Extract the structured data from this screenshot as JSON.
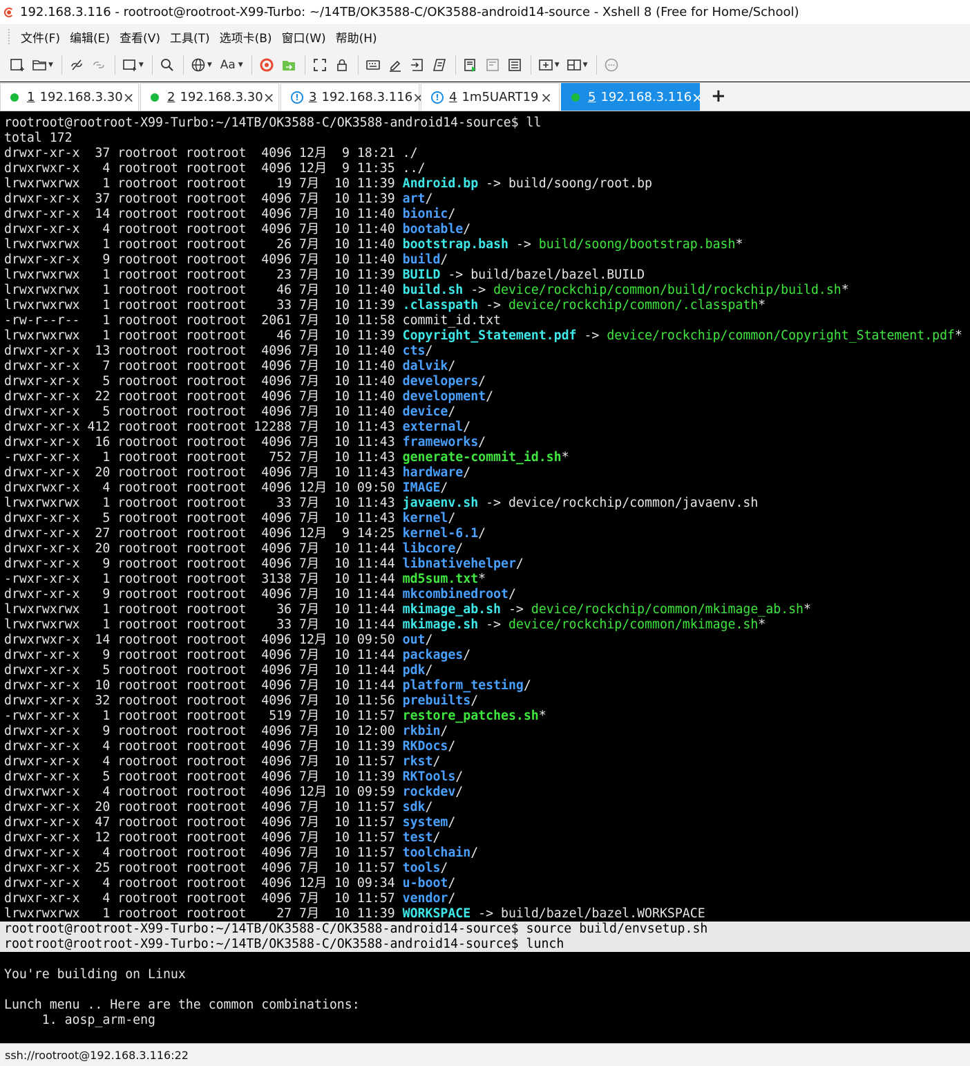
{
  "window": {
    "title": "192.168.3.116 - rootroot@rootroot-X99-Turbo: ~/14TB/OK3588-C/OK3588-android14-source - Xshell 8 (Free for Home/School)"
  },
  "menu": [
    "文件(F)",
    "编辑(E)",
    "查看(V)",
    "工具(T)",
    "选项卡(B)",
    "窗口(W)",
    "帮助(H)"
  ],
  "toolbar": {
    "font_label": "Aa",
    "icons": [
      "new-session-icon",
      "open-folder-icon",
      "disconnect-icon",
      "reconnect-icon",
      "new-window-icon",
      "find-icon",
      "globe-icon",
      "font-icon",
      "xshell-logo-icon",
      "xftp-icon",
      "fullscreen-icon",
      "lock-icon",
      "keyboard-icon",
      "highlight-icon",
      "transfer-icon",
      "script-icon",
      "compose-icon",
      "compose-bar-icon",
      "compose-pane-icon",
      "add-tab-icon",
      "layout-icon",
      "chat-icon"
    ]
  },
  "tabs": [
    {
      "num": "1",
      "host": "192.168.3.30",
      "status": "connected",
      "active": false
    },
    {
      "num": "2",
      "host": "192.168.3.30",
      "status": "connected",
      "active": false
    },
    {
      "num": "3",
      "host": "192.168.3.116",
      "status": "warning",
      "active": false
    },
    {
      "num": "4",
      "host": "1m5UART19",
      "status": "warning",
      "active": false
    },
    {
      "num": "5",
      "host": "192.168.3.116",
      "status": "connected",
      "active": true
    }
  ],
  "tab_close_glyph": "×",
  "tab_add_glyph": "+",
  "terminal": {
    "prompt": "rootroot@rootroot-X99-Turbo:~/14TB/OK3588-C/OK3588-android14-source$",
    "commands": {
      "ll": "ll",
      "source": "source build/envsetup.sh",
      "lunch": "lunch"
    },
    "total": "total 172",
    "listing": [
      {
        "meta": "drwxr-xr-x  37 rootroot rootroot  4096 12月  9 18:21",
        "name": "./",
        "kind": "plain"
      },
      {
        "meta": "drwxrwxr-x   4 rootroot rootroot  4096 12月  9 11:35",
        "name": "../",
        "kind": "plain"
      },
      {
        "meta": "lrwxrwxrwx   1 rootroot rootroot    19 7月  10 11:39",
        "name": "Android.bp",
        "kind": "lnk",
        "arrow": "->",
        "target": "build/soong/root.bp",
        "tkind": "plain",
        "star": ""
      },
      {
        "meta": "drwxr-xr-x  37 rootroot rootroot  4096 7月  10 11:39",
        "name": "art",
        "kind": "dir"
      },
      {
        "meta": "drwxr-xr-x  14 rootroot rootroot  4096 7月  10 11:40",
        "name": "bionic",
        "kind": "dir"
      },
      {
        "meta": "drwxr-xr-x   4 rootroot rootroot  4096 7月  10 11:40",
        "name": "bootable",
        "kind": "dir"
      },
      {
        "meta": "lrwxrwxrwx   1 rootroot rootroot    26 7月  10 11:40",
        "name": "bootstrap.bash",
        "kind": "lnk",
        "arrow": "->",
        "target": "build/soong/bootstrap.bash",
        "tkind": "exe",
        "star": "*"
      },
      {
        "meta": "drwxr-xr-x   9 rootroot rootroot  4096 7月  10 11:40",
        "name": "build",
        "kind": "dir"
      },
      {
        "meta": "lrwxrwxrwx   1 rootroot rootroot    23 7月  10 11:39",
        "name": "BUILD",
        "kind": "lnk",
        "arrow": "->",
        "target": "build/bazel/bazel.BUILD",
        "tkind": "plain",
        "star": ""
      },
      {
        "meta": "lrwxrwxrwx   1 rootroot rootroot    46 7月  10 11:40",
        "name": "build.sh",
        "kind": "lnk",
        "arrow": "->",
        "target": "device/rockchip/common/build/rockchip/build.sh",
        "tkind": "exe",
        "star": "*"
      },
      {
        "meta": "lrwxrwxrwx   1 rootroot rootroot    33 7月  10 11:39",
        "name": ".classpath",
        "kind": "lnk",
        "arrow": "->",
        "target": "device/rockchip/common/.classpath",
        "tkind": "exe",
        "star": "*"
      },
      {
        "meta": "-rw-r--r--   1 rootroot rootroot  2061 7月  10 11:58",
        "name": "commit_id.txt",
        "kind": "plain"
      },
      {
        "meta": "lrwxrwxrwx   1 rootroot rootroot    46 7月  10 11:39",
        "name": "Copyright_Statement.pdf",
        "kind": "lnk",
        "arrow": "->",
        "target": "device/rockchip/common/Copyright_Statement.pdf",
        "tkind": "exe",
        "star": "*"
      },
      {
        "meta": "drwxr-xr-x  13 rootroot rootroot  4096 7月  10 11:40",
        "name": "cts",
        "kind": "dir"
      },
      {
        "meta": "drwxr-xr-x   7 rootroot rootroot  4096 7月  10 11:40",
        "name": "dalvik",
        "kind": "dir"
      },
      {
        "meta": "drwxr-xr-x   5 rootroot rootroot  4096 7月  10 11:40",
        "name": "developers",
        "kind": "dir"
      },
      {
        "meta": "drwxr-xr-x  22 rootroot rootroot  4096 7月  10 11:40",
        "name": "development",
        "kind": "dir"
      },
      {
        "meta": "drwxr-xr-x   5 rootroot rootroot  4096 7月  10 11:40",
        "name": "device",
        "kind": "dir"
      },
      {
        "meta": "drwxr-xr-x 412 rootroot rootroot 12288 7月  10 11:43",
        "name": "external",
        "kind": "dir"
      },
      {
        "meta": "drwxr-xr-x  16 rootroot rootroot  4096 7月  10 11:43",
        "name": "frameworks",
        "kind": "dir"
      },
      {
        "meta": "-rwxr-xr-x   1 rootroot rootroot   752 7月  10 11:43",
        "name": "generate-commit_id.sh",
        "kind": "exe"
      },
      {
        "meta": "drwxr-xr-x  20 rootroot rootroot  4096 7月  10 11:43",
        "name": "hardware",
        "kind": "dir"
      },
      {
        "meta": "drwxrwxr-x   4 rootroot rootroot  4096 12月 10 09:50",
        "name": "IMAGE",
        "kind": "dir"
      },
      {
        "meta": "lrwxrwxrwx   1 rootroot rootroot    33 7月  10 11:43",
        "name": "javaenv.sh",
        "kind": "lnk",
        "arrow": "->",
        "target": "device/rockchip/common/javaenv.sh",
        "tkind": "plain",
        "star": ""
      },
      {
        "meta": "drwxr-xr-x   5 rootroot rootroot  4096 7月  10 11:43",
        "name": "kernel",
        "kind": "dir"
      },
      {
        "meta": "drwxr-xr-x  27 rootroot rootroot  4096 12月  9 14:25",
        "name": "kernel-6.1",
        "kind": "dir"
      },
      {
        "meta": "drwxr-xr-x  20 rootroot rootroot  4096 7月  10 11:44",
        "name": "libcore",
        "kind": "dir"
      },
      {
        "meta": "drwxr-xr-x   9 rootroot rootroot  4096 7月  10 11:44",
        "name": "libnativehelper",
        "kind": "dir"
      },
      {
        "meta": "-rwxr-xr-x   1 rootroot rootroot  3138 7月  10 11:44",
        "name": "md5sum.txt",
        "kind": "exe"
      },
      {
        "meta": "drwxr-xr-x   9 rootroot rootroot  4096 7月  10 11:44",
        "name": "mkcombinedroot",
        "kind": "dir"
      },
      {
        "meta": "lrwxrwxrwx   1 rootroot rootroot    36 7月  10 11:44",
        "name": "mkimage_ab.sh",
        "kind": "lnk",
        "arrow": "->",
        "target": "device/rockchip/common/mkimage_ab.sh",
        "tkind": "exe",
        "star": "*"
      },
      {
        "meta": "lrwxrwxrwx   1 rootroot rootroot    33 7月  10 11:44",
        "name": "mkimage.sh",
        "kind": "lnk",
        "arrow": "->",
        "target": "device/rockchip/common/mkimage.sh",
        "tkind": "exe",
        "star": "*"
      },
      {
        "meta": "drwxrwxr-x  14 rootroot rootroot  4096 12月 10 09:50",
        "name": "out",
        "kind": "dir"
      },
      {
        "meta": "drwxr-xr-x   9 rootroot rootroot  4096 7月  10 11:44",
        "name": "packages",
        "kind": "dir"
      },
      {
        "meta": "drwxr-xr-x   5 rootroot rootroot  4096 7月  10 11:44",
        "name": "pdk",
        "kind": "dir"
      },
      {
        "meta": "drwxr-xr-x  10 rootroot rootroot  4096 7月  10 11:44",
        "name": "platform_testing",
        "kind": "dir"
      },
      {
        "meta": "drwxr-xr-x  32 rootroot rootroot  4096 7月  10 11:56",
        "name": "prebuilts",
        "kind": "dir"
      },
      {
        "meta": "-rwxr-xr-x   1 rootroot rootroot   519 7月  10 11:57",
        "name": "restore_patches.sh",
        "kind": "exe"
      },
      {
        "meta": "drwxr-xr-x   9 rootroot rootroot  4096 7月  10 12:00",
        "name": "rkbin",
        "kind": "dir"
      },
      {
        "meta": "drwxr-xr-x   4 rootroot rootroot  4096 7月  10 11:39",
        "name": "RKDocs",
        "kind": "dir"
      },
      {
        "meta": "drwxr-xr-x   4 rootroot rootroot  4096 7月  10 11:57",
        "name": "rkst",
        "kind": "dir"
      },
      {
        "meta": "drwxr-xr-x   5 rootroot rootroot  4096 7月  10 11:39",
        "name": "RKTools",
        "kind": "dir"
      },
      {
        "meta": "drwxrwxr-x   4 rootroot rootroot  4096 12月 10 09:59",
        "name": "rockdev",
        "kind": "dir"
      },
      {
        "meta": "drwxr-xr-x  20 rootroot rootroot  4096 7月  10 11:57",
        "name": "sdk",
        "kind": "dir"
      },
      {
        "meta": "drwxr-xr-x  47 rootroot rootroot  4096 7月  10 11:57",
        "name": "system",
        "kind": "dir"
      },
      {
        "meta": "drwxr-xr-x  12 rootroot rootroot  4096 7月  10 11:57",
        "name": "test",
        "kind": "dir"
      },
      {
        "meta": "drwxr-xr-x   4 rootroot rootroot  4096 7月  10 11:57",
        "name": "toolchain",
        "kind": "dir"
      },
      {
        "meta": "drwxr-xr-x  25 rootroot rootroot  4096 7月  10 11:57",
        "name": "tools",
        "kind": "dir"
      },
      {
        "meta": "drwxr-xr-x   4 rootroot rootroot  4096 12月 10 09:34",
        "name": "u-boot",
        "kind": "dir"
      },
      {
        "meta": "drwxr-xr-x   4 rootroot rootroot  4096 7月  10 11:57",
        "name": "vendor",
        "kind": "dir"
      },
      {
        "meta": "lrwxrwxrwx   1 rootroot rootroot    27 7月  10 11:39",
        "name": "WORKSPACE",
        "kind": "lnk",
        "arrow": "->",
        "target": "build/bazel/bazel.WORKSPACE",
        "tkind": "plain",
        "star": ""
      }
    ],
    "after": [
      "",
      "You're building on Linux",
      "",
      "Lunch menu .. Here are the common combinations:",
      "     1. aosp_arm-eng"
    ]
  },
  "status": {
    "connection": "ssh://rootroot@192.168.3.116:22"
  }
}
